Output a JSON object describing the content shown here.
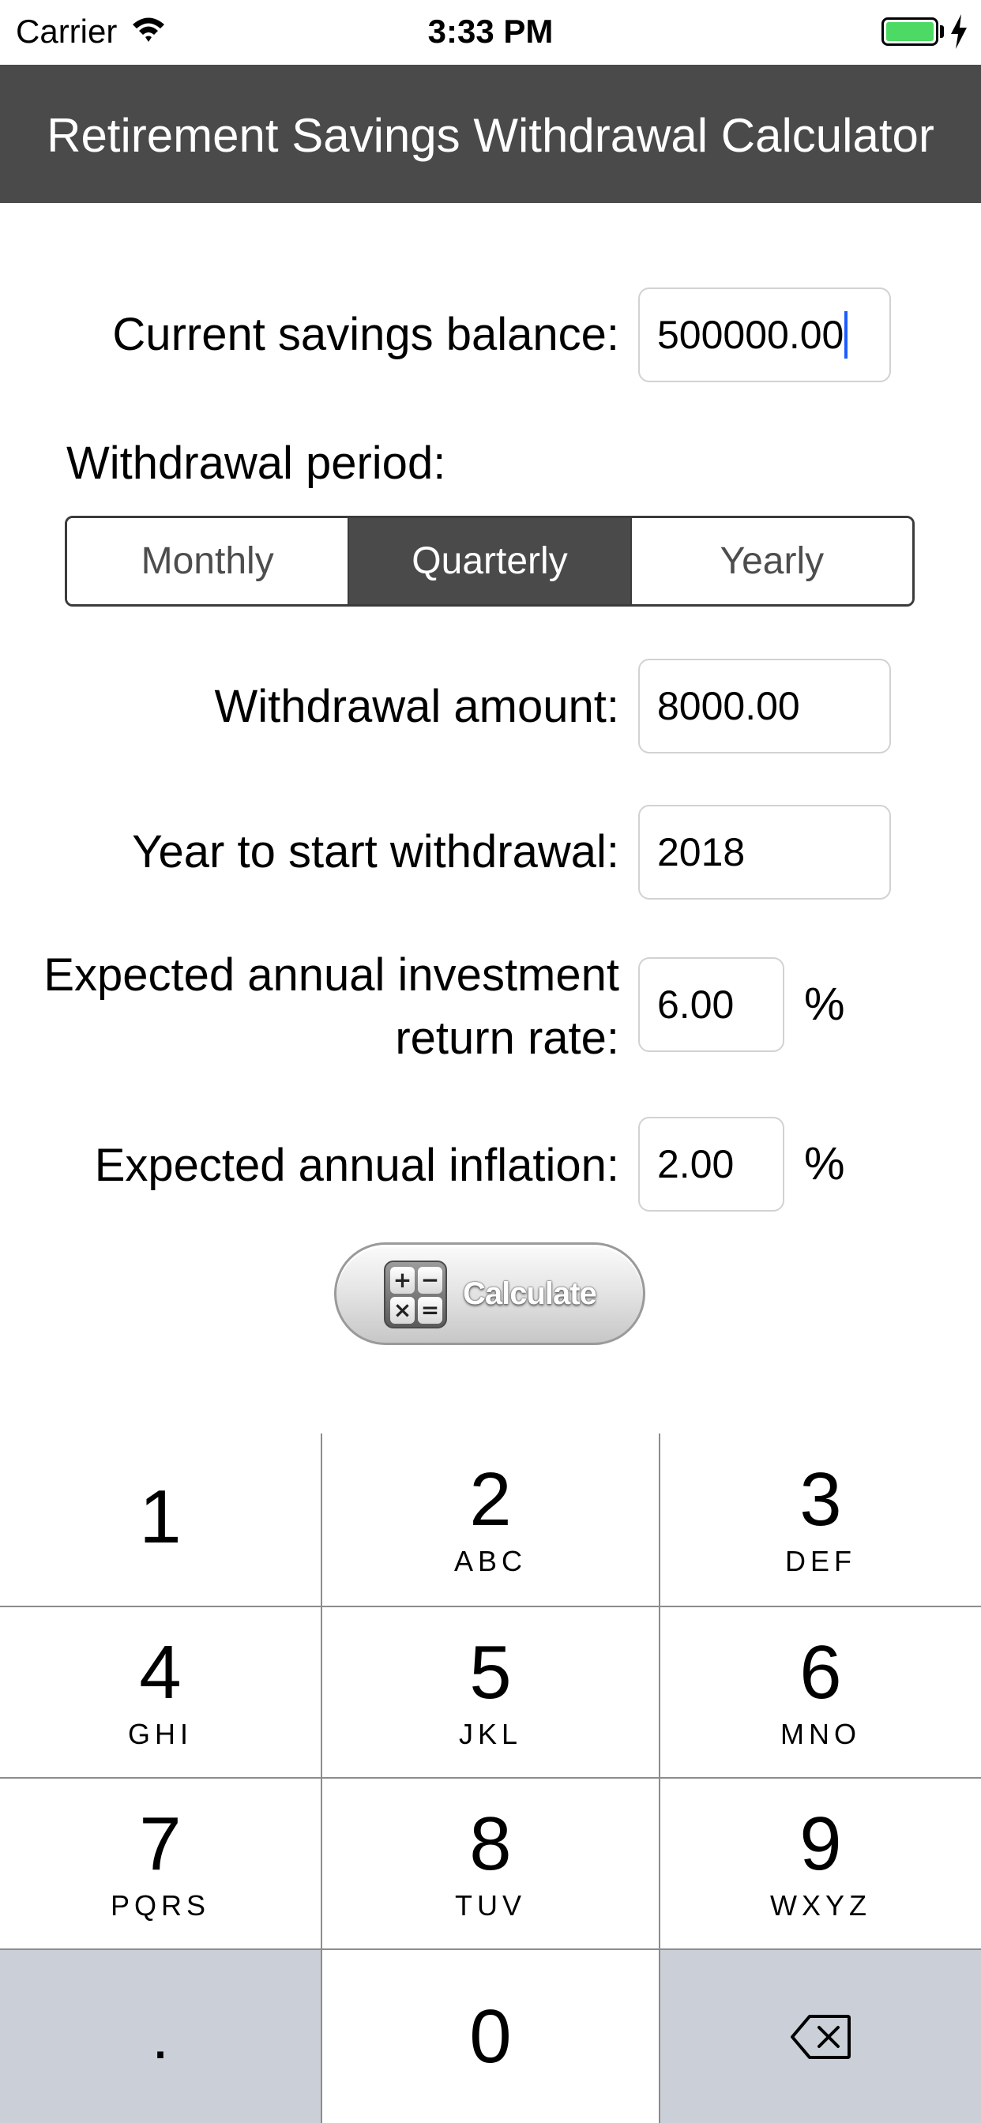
{
  "status_bar": {
    "carrier": "Carrier",
    "time": "3:33 PM",
    "wifi_icon": "wifi-icon",
    "battery_icon": "battery-icon",
    "charging_icon": "bolt-icon",
    "battery_color": "#4cd964"
  },
  "nav": {
    "title": "Retirement Savings Withdrawal Calculator",
    "background_color": "#4a4a4a"
  },
  "form": {
    "savings_label": "Current savings balance:",
    "savings_value": "500000.00",
    "period_label": "Withdrawal period:",
    "period_options": [
      "Monthly",
      "Quarterly",
      "Yearly"
    ],
    "period_selected": "Quarterly",
    "amount_label": "Withdrawal amount:",
    "amount_value": "8000.00",
    "start_year_label": "Year to start withdrawal:",
    "start_year_value": "2018",
    "return_rate_label_line1": "Expected annual investment",
    "return_rate_label_line2": "return rate:",
    "return_rate_value": "6.00",
    "inflation_label": "Expected annual inflation:",
    "inflation_value": "2.00",
    "percent_symbol": "%"
  },
  "calculate_button": {
    "label": "Calculate",
    "icon": "calculator-icon",
    "icon_symbols": [
      "+",
      "−",
      "×",
      "="
    ]
  },
  "keypad": {
    "keys": [
      {
        "digit": "1",
        "letters": ""
      },
      {
        "digit": "2",
        "letters": "ABC"
      },
      {
        "digit": "3",
        "letters": "DEF"
      },
      {
        "digit": "4",
        "letters": "GHI"
      },
      {
        "digit": "5",
        "letters": "JKL"
      },
      {
        "digit": "6",
        "letters": "MNO"
      },
      {
        "digit": "7",
        "letters": "PQRS"
      },
      {
        "digit": "8",
        "letters": "TUV"
      },
      {
        "digit": "9",
        "letters": "WXYZ"
      }
    ],
    "decimal_key": ".",
    "zero_key": "0",
    "delete_icon": "backspace-icon",
    "gray_key_color": "#cbd0d8"
  }
}
